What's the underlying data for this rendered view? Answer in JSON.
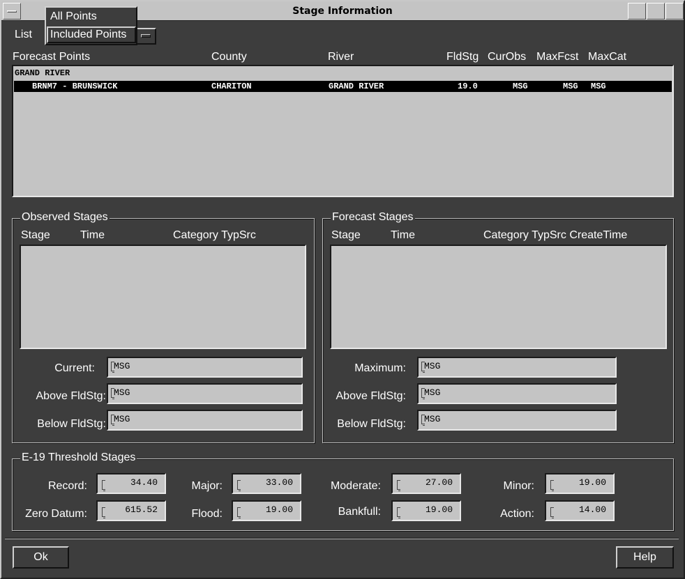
{
  "window": {
    "title": "Stage Information"
  },
  "list_selector": {
    "label": "List",
    "options": [
      "All Points",
      "Included Points"
    ],
    "selected": "Included Points"
  },
  "forecast_points": {
    "headers": {
      "point": "Forecast Points",
      "county": "County",
      "river": "River",
      "fldstg": "FldStg",
      "curobs": "CurObs",
      "maxfcst": "MaxFcst",
      "maxcat": "MaxCat"
    },
    "group_row": "GRAND RIVER",
    "rows": [
      {
        "point": "BRNM7 - BRUNSWICK",
        "county": "CHARITON",
        "river": "GRAND RIVER",
        "fldstg": "19.0",
        "curobs": "MSG",
        "maxfcst": "MSG",
        "maxcat": "MSG"
      }
    ]
  },
  "observed": {
    "title": "Observed Stages",
    "headers": {
      "stage": "Stage",
      "time": "Time",
      "catsrc": "Category TypSrc"
    },
    "current_label": "Current:",
    "current_value": "MSG",
    "above_label": "Above FldStg:",
    "above_value": "MSG",
    "below_label": "Below FldStg:",
    "below_value": "MSG"
  },
  "forecast": {
    "title": "Forecast Stages",
    "headers": {
      "stage": "Stage",
      "time": "Time",
      "catsrc": "Category TypSrc CreateTime"
    },
    "maximum_label": "Maximum:",
    "maximum_value": "MSG",
    "above_label": "Above FldStg:",
    "above_value": "MSG",
    "below_label": "Below FldStg:",
    "below_value": "MSG"
  },
  "thresholds": {
    "title": "E-19 Threshold Stages",
    "record_label": "Record:",
    "record_value": "34.40",
    "major_label": "Major:",
    "major_value": "33.00",
    "moderate_label": "Moderate:",
    "moderate_value": "27.00",
    "minor_label": "Minor:",
    "minor_value": "19.00",
    "zero_label": "Zero Datum:",
    "zero_value": "615.52",
    "flood_label": "Flood:",
    "flood_value": "19.00",
    "bankfull_label": "Bankfull:",
    "bankfull_value": "19.00",
    "action_label": "Action:",
    "action_value": "14.00"
  },
  "buttons": {
    "ok": "Ok",
    "help": "Help"
  }
}
